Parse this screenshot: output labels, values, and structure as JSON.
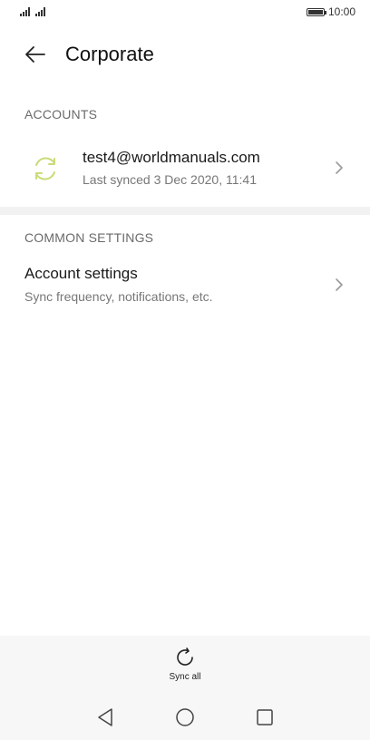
{
  "status_bar": {
    "time": "10:00"
  },
  "header": {
    "title": "Corporate"
  },
  "sections": {
    "accounts_label": "ACCOUNTS",
    "common_label": "COMMON SETTINGS"
  },
  "account": {
    "email": "test4@worldmanuals.com",
    "last_synced": "Last synced 3 Dec 2020, 11:41",
    "icon": "sync-icon",
    "icon_color": "#c8dc7a"
  },
  "settings": {
    "title": "Account settings",
    "subtitle": "Sync frequency, notifications, etc."
  },
  "action_bar": {
    "sync_all_label": "Sync all"
  },
  "colors": {
    "background": "#ffffff",
    "divider": "#f2f2f2",
    "bar_background": "#f7f7f7",
    "secondary_text": "#777777"
  }
}
